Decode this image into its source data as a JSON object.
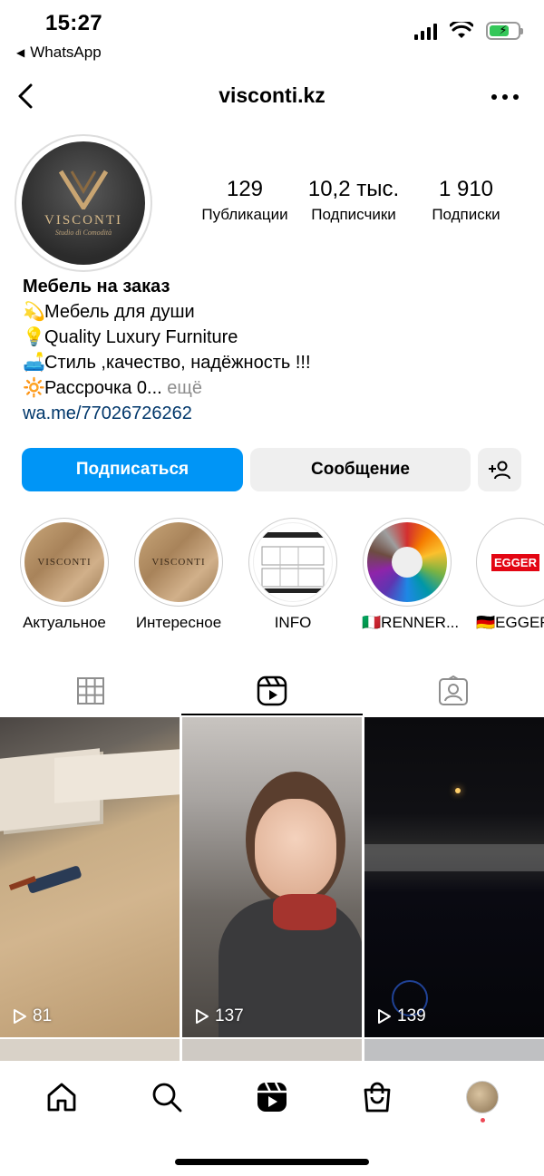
{
  "status_bar": {
    "time": "15:27",
    "back_app": "WhatsApp"
  },
  "header": {
    "username": "visconti.kz"
  },
  "profile": {
    "avatar_logo_text": "VISCONTI",
    "avatar_logo_sub": "Studio di Comodità",
    "stats": [
      {
        "value": "129",
        "label": "Публикации"
      },
      {
        "value": "10,2 тыс.",
        "label": "Подписчики"
      },
      {
        "value": "1 910",
        "label": "Подписки"
      }
    ]
  },
  "bio": {
    "name": "Мебель на заказ",
    "lines": [
      {
        "emoji": "💫",
        "text": "Мебель для души"
      },
      {
        "emoji": "💡",
        "text": "Quality Luxury Furniture"
      },
      {
        "emoji": "🛋️",
        "text": "Стиль ,качество, надёжность !!!"
      },
      {
        "emoji": "🔆",
        "text": "Рассрочка 0..."
      }
    ],
    "more": "ещё",
    "link": "wa.me/77026726262"
  },
  "actions": {
    "follow": "Подписаться",
    "message": "Сообщение"
  },
  "highlights": [
    {
      "label": "Актуальное"
    },
    {
      "label": "Интересное"
    },
    {
      "label": "INFO"
    },
    {
      "label": "🇮🇹RENNER..."
    },
    {
      "label": "🇩🇪EGGER"
    }
  ],
  "highlight_texts": {
    "visconti": "VISCONTI",
    "egger": "EGGER"
  },
  "tabs": [
    {
      "icon": "grid-icon"
    },
    {
      "icon": "reels-icon"
    },
    {
      "icon": "tagged-icon"
    }
  ],
  "reels": [
    {
      "views": "81"
    },
    {
      "views": "137"
    },
    {
      "views": "139"
    }
  ],
  "colors": {
    "accent": "#0095f6",
    "link": "#00376b",
    "muted": "#8e8e8e"
  }
}
